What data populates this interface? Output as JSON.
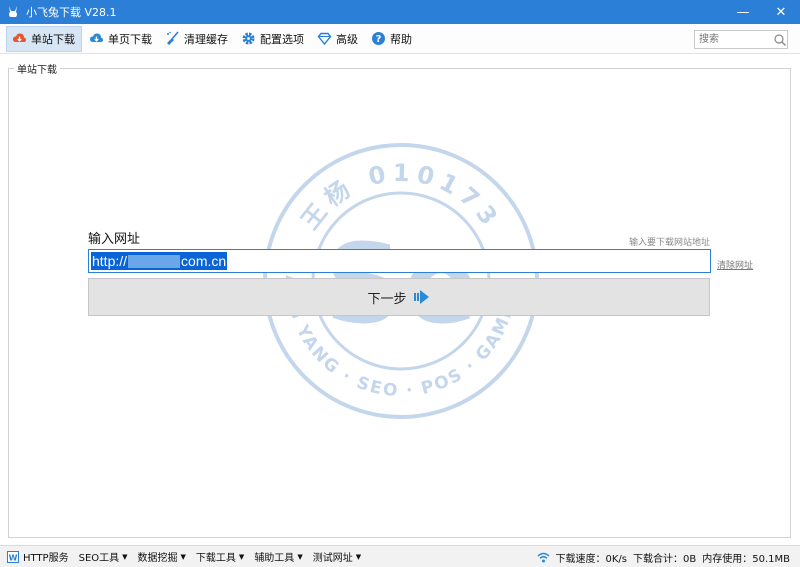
{
  "window": {
    "title": "小飞兔下载 V28.1",
    "minimize_glyph": "—",
    "close_glyph": "✕",
    "accent_color": "#2b7fd6"
  },
  "toolbar": {
    "items": [
      {
        "label": "单站下载",
        "icon": "cloud-download-icon",
        "active": true
      },
      {
        "label": "单页下载",
        "icon": "cloud-download-icon",
        "active": false
      },
      {
        "label": "清理缓存",
        "icon": "broom-icon",
        "active": false
      },
      {
        "label": "配置选项",
        "icon": "gear-icon",
        "active": false
      },
      {
        "label": "高级",
        "icon": "diamond-icon",
        "active": false
      },
      {
        "label": "帮助",
        "icon": "help-icon",
        "active": false
      }
    ],
    "search_placeholder": "搜索"
  },
  "main": {
    "group_label": "单站下载",
    "url_label": "输入网址",
    "url_hint": "输入要下载网站地址",
    "url_prefix": "http://",
    "url_suffix": "com.cn",
    "clear_link": "清除网址",
    "next_button": "下一步"
  },
  "watermark": {
    "top_text": "王杨 010173",
    "bottom_text": "WANG YANG · SEO · POS · GAME CPS",
    "logo_letters": "Se"
  },
  "statusbar": {
    "items": [
      {
        "label": "HTTP服务",
        "dropdown": false
      },
      {
        "label": "SEO工具",
        "dropdown": true
      },
      {
        "label": "数据挖掘",
        "dropdown": true
      },
      {
        "label": "下载工具",
        "dropdown": true
      },
      {
        "label": "辅助工具",
        "dropdown": true
      },
      {
        "label": "测试网址",
        "dropdown": true
      }
    ],
    "download_speed": "下载速度：0K/s",
    "download_total": "下载合计：0B",
    "memory_usage": "内存使用：50.1MB"
  }
}
